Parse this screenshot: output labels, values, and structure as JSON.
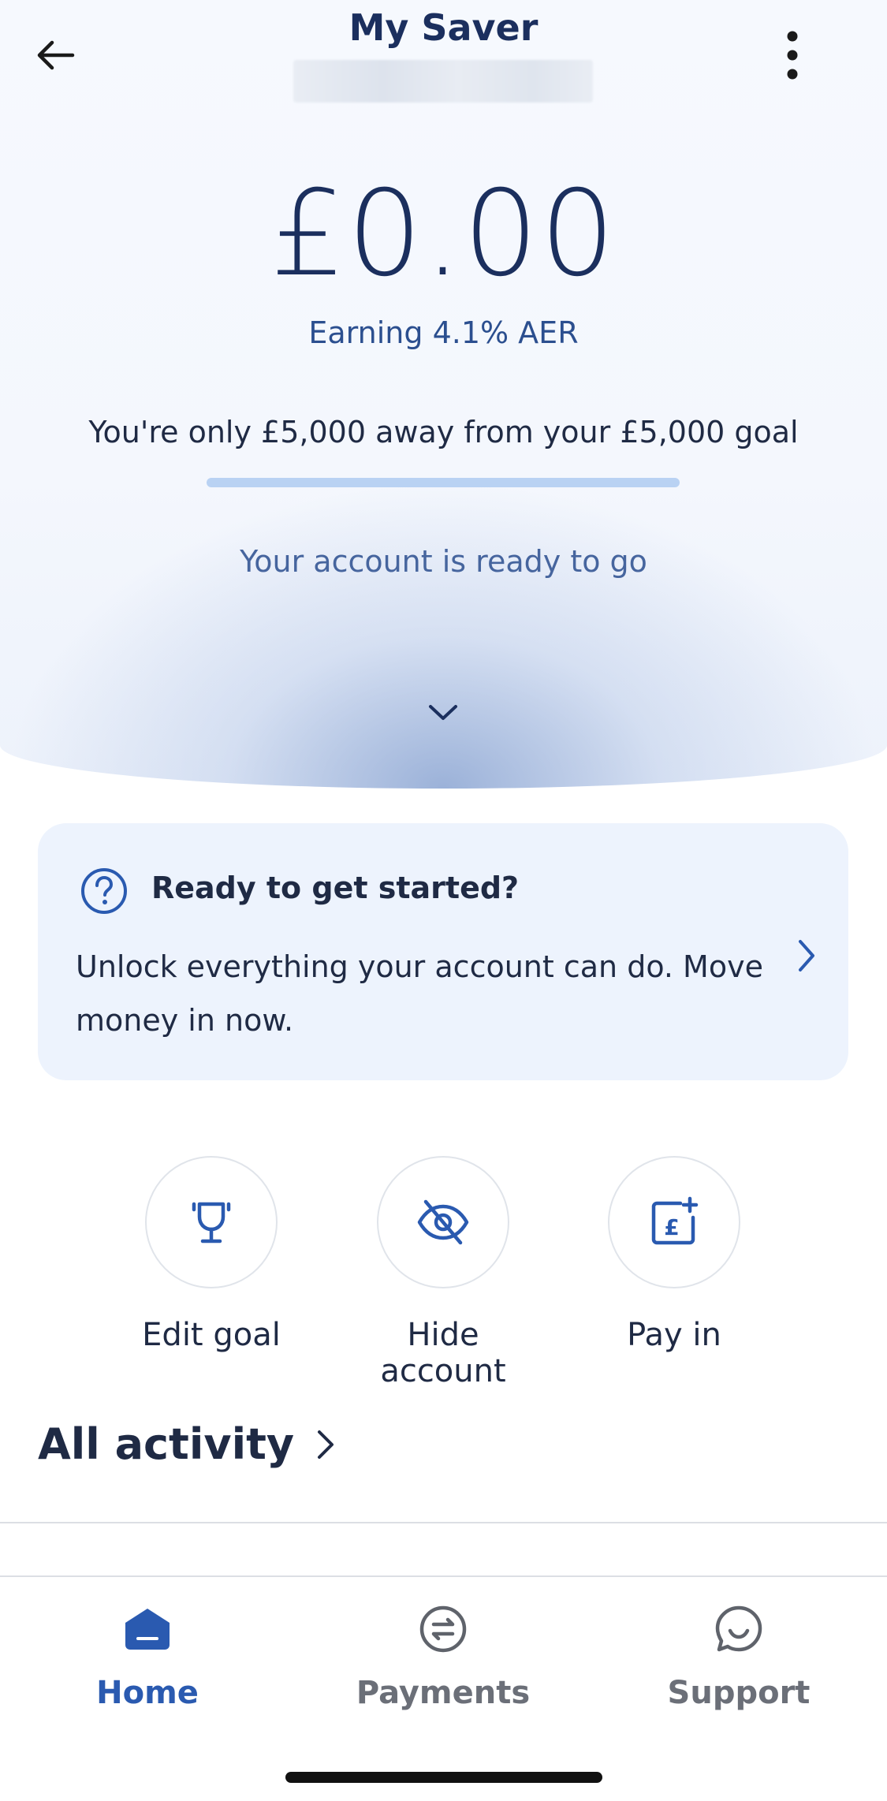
{
  "header": {
    "title": "My Saver"
  },
  "balance": {
    "amount": "£0.00",
    "earning": "Earning 4.1% AER"
  },
  "goal": {
    "text": "You're only £5,000 away from your £5,000 goal",
    "progress_percent": 0
  },
  "status": {
    "text": "Your account is ready to go"
  },
  "card": {
    "title": "Ready to get started?",
    "body": "Unlock everything your account can do. Move money in now."
  },
  "actions": [
    {
      "label": "Edit goal",
      "icon": "trophy-icon"
    },
    {
      "label": "Hide account",
      "icon": "eye-off-icon"
    },
    {
      "label": "Pay in",
      "icon": "pay-in-icon"
    }
  ],
  "activity": {
    "label": "All activity"
  },
  "tabs": [
    {
      "label": "Home",
      "icon": "home-icon",
      "active": true
    },
    {
      "label": "Payments",
      "icon": "transfer-icon",
      "active": false
    },
    {
      "label": "Support",
      "icon": "chat-icon",
      "active": false
    }
  ],
  "colors": {
    "brand_navy": "#1b2f5e",
    "accent_blue": "#2a5ab0",
    "tab_inactive": "#6b6f78",
    "card_bg": "#edf3fd"
  }
}
